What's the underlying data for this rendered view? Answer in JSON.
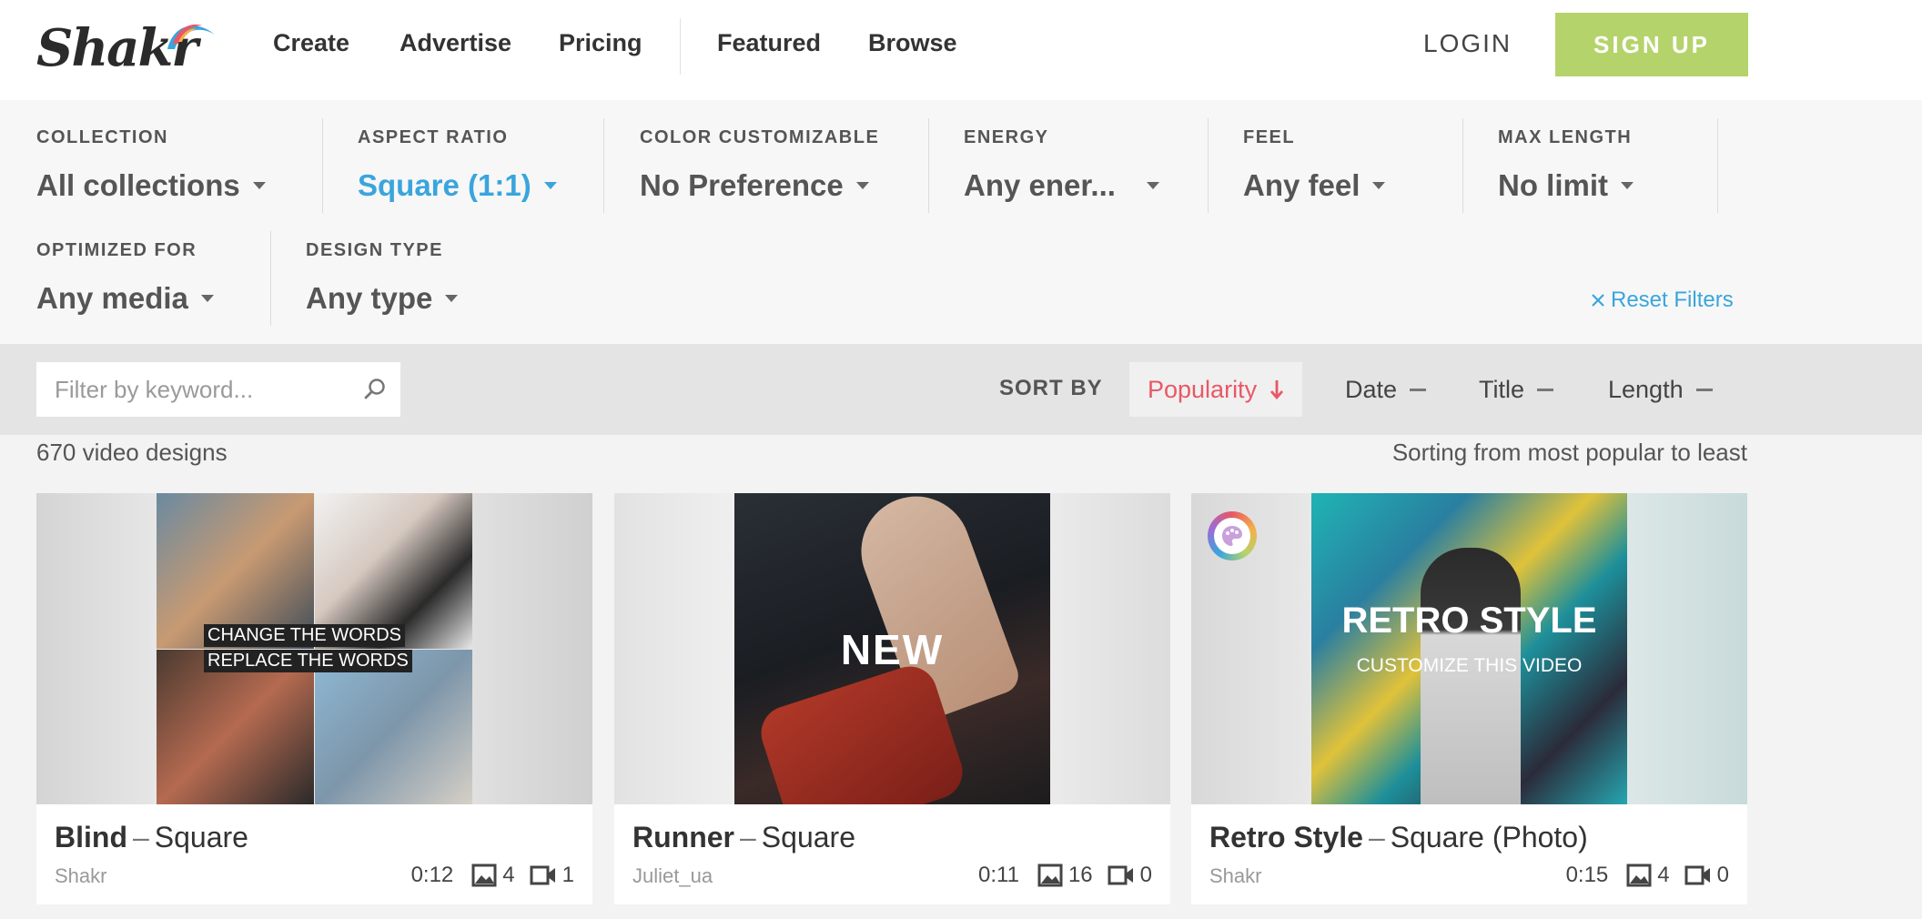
{
  "brand": {
    "logo_text": "Shakr"
  },
  "nav": [
    "Create",
    "Advertise",
    "Pricing",
    "Featured",
    "Browse"
  ],
  "auth": {
    "login": "LOGIN",
    "signup": "SIGN UP"
  },
  "filters": [
    {
      "label": "COLLECTION",
      "value": "All collections"
    },
    {
      "label": "ASPECT RATIO",
      "value": "Square (1:1)",
      "active": true
    },
    {
      "label": "COLOR CUSTOMIZABLE",
      "value": "No Preference"
    },
    {
      "label": "ENERGY",
      "value": "Any ener..."
    },
    {
      "label": "FEEL",
      "value": "Any feel"
    },
    {
      "label": "MAX LENGTH",
      "value": "No limit"
    },
    {
      "label": "OPTIMIZED FOR",
      "value": "Any media"
    },
    {
      "label": "DESIGN TYPE",
      "value": "Any type"
    }
  ],
  "reset_filters": "Reset Filters",
  "search": {
    "placeholder": "Filter by keyword..."
  },
  "sort": {
    "label": "SORT BY",
    "options": [
      "Popularity",
      "Date",
      "Title",
      "Length"
    ],
    "active": "Popularity"
  },
  "results": {
    "count": "670 video designs",
    "sort_description": "Sorting from most popular to least"
  },
  "cards": [
    {
      "title": "Blind",
      "variant": "Square",
      "author": "Shakr",
      "duration": "0:12",
      "images": "4",
      "videos": "1",
      "overlay": [
        "CHANGE THE WORDS",
        "REPLACE THE WORDS"
      ]
    },
    {
      "title": "Runner",
      "variant": "Square",
      "author": "Juliet_ua",
      "duration": "0:11",
      "images": "16",
      "videos": "0",
      "overlay": [
        "NEW"
      ]
    },
    {
      "title": "Retro Style",
      "variant": "Square (Photo)",
      "author": "Shakr",
      "duration": "0:15",
      "images": "4",
      "videos": "0",
      "overlay": [
        "RETRO STYLE",
        "CUSTOMIZE THIS VIDEO"
      ],
      "color_customizable": true
    }
  ],
  "colors": {
    "accent_green": "#b5d36b",
    "accent_blue": "#3aa5dc",
    "accent_red": "#e85866"
  }
}
